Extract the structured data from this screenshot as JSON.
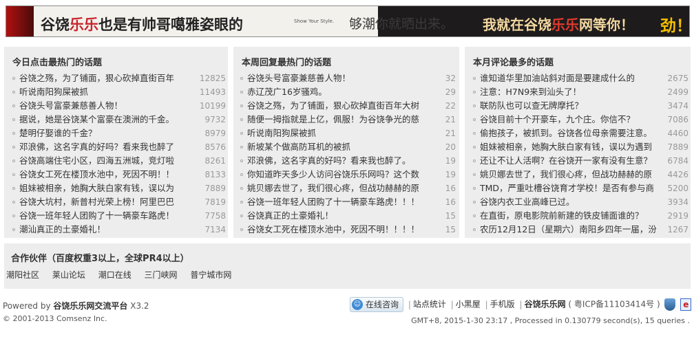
{
  "banner": {
    "part1_a": "谷饶",
    "part1_hl": "乐乐",
    "part1_b": "也是有帅哥噶雅姿眼的",
    "slogan_en": "Show Your Style.",
    "slogan_cn": "够潮你就晒出来。",
    "part2_a": "我就在谷饶",
    "part2_hl": "乐乐",
    "part2_b": "网等你！",
    "part2_end": "劲！"
  },
  "today": {
    "title": "今日点击最热门的话题",
    "items": [
      {
        "title": "谷饶之殇，为了铺面，狠心砍掉直街百年",
        "num": "12825"
      },
      {
        "title": "听说南阳狗屎被抓",
        "num": "11493"
      },
      {
        "title": "谷饶头号富豪兼慈善人物！",
        "num": "10199"
      },
      {
        "title": "据说，她是谷饶某个富豪在澳洲的千金。",
        "num": "9732"
      },
      {
        "title": "楚明仔娶谁的千金？",
        "num": "8979"
      },
      {
        "title": "邓浪佛，这名字真的好吗？看来我也醉了",
        "num": "8576"
      },
      {
        "title": "谷饶高端住宅小区，四海五洲城，竞灯啦",
        "num": "8261"
      },
      {
        "title": "谷饶女工死在楼顶水池中，死因不明！！",
        "num": "8133"
      },
      {
        "title": "姐妹被相亲，她胸大肤白家有钱，误以为",
        "num": "7889"
      },
      {
        "title": "谷饶大坑村，新普村光荣上榜！阿里巴巴",
        "num": "7819"
      },
      {
        "title": "谷饶一班年轻人团购了十一辆豪车路虎！",
        "num": "7758"
      },
      {
        "title": "潮汕真正的土豪婚礼！",
        "num": "7134"
      }
    ]
  },
  "week": {
    "title": "本周回复最热门的话题",
    "items": [
      {
        "title": "谷饶头号富豪兼慈善人物！",
        "num": "32"
      },
      {
        "title": "赤辽茂广16岁骚鸡。",
        "num": "29"
      },
      {
        "title": "谷饶之殇，为了铺面，狠心砍掉直街百年大树",
        "num": "22"
      },
      {
        "title": "随便一拇指就是上亿，佩服！为谷饶争光的慈",
        "num": "21"
      },
      {
        "title": "听说南阳狗屎被抓",
        "num": "21"
      },
      {
        "title": "新坡某个做高防耳机的被抓",
        "num": "20"
      },
      {
        "title": "邓浪佛，这名字真的好吗？看来我也醉了。",
        "num": "19"
      },
      {
        "title": "你知道昨天多少人访问谷饶乐乐网吗？这个数",
        "num": "19"
      },
      {
        "title": "姚贝娜去世了，我们很心疼，但战功赫赫的原",
        "num": "16"
      },
      {
        "title": "谷饶一班年轻人团购了十一辆豪车路虎！！！",
        "num": "16"
      },
      {
        "title": "谷饶真正的土豪婚礼！",
        "num": "15"
      },
      {
        "title": "谷饶女工死在楼顶水池中，死因不明！！！！",
        "num": "15"
      }
    ]
  },
  "month": {
    "title": "本月评论最多的话题",
    "items": [
      {
        "title": "谁知道华里加油站斜对面是要建成什么的",
        "num": "2675"
      },
      {
        "title": "注意：H7N9来到汕头了！",
        "num": "2499"
      },
      {
        "title": "联防队也可以查无牌摩托？",
        "num": "3474"
      },
      {
        "title": "谷饶目前十个开豪车，九个庄。你信不？",
        "num": "7086"
      },
      {
        "title": "偷抱孩子，被抓到。谷饶各位母亲需要注意。",
        "num": "4460"
      },
      {
        "title": "姐妹被相亲，她胸大肤白家有钱，误以为遇到",
        "num": "7889"
      },
      {
        "title": "还让不让人活啊？在谷饶开一家有没有生意？",
        "num": "6784"
      },
      {
        "title": "姚贝娜去世了，我们很心疼，但战功赫赫的原",
        "num": "4426"
      },
      {
        "title": "TMD，严重吐槽谷饶育才学校！是否有参与商",
        "num": "5200"
      },
      {
        "title": "谷饶内衣工业高峰已过。",
        "num": "3934"
      },
      {
        "title": "在直街，原电影院前新建的铁皮铺面谁的？",
        "num": "2919"
      },
      {
        "title": "农历12月12日（星期六）南阳乡四年一届，汾",
        "num": "1267"
      }
    ]
  },
  "partners": {
    "title": "合作伙伴（百度权重3以上，全球PR4以上）",
    "links": [
      "潮阳社区",
      "莱山论坛",
      "潮口在线",
      "三门峡网",
      "普宁城市网"
    ]
  },
  "footer": {
    "powered_prefix": "Powered by",
    "powered_name": "谷饶乐乐网交流平台",
    "powered_version": "X3.2",
    "copyright": "© 2001-2013 Comsenz Inc.",
    "consult_label": "在线咨询",
    "links": [
      "站点统计",
      "小黑屋",
      "手机版"
    ],
    "site_name": "谷饶乐乐网",
    "icp": "( 粤ICP备11103414号 )",
    "stats": "GMT+8, 2015-1-30 23:17 , Processed in 0.130779 second(s), 15 queries ."
  }
}
